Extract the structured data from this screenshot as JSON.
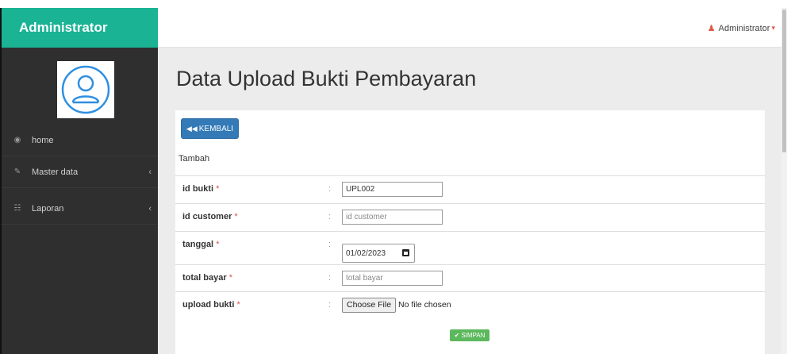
{
  "brand": {
    "title": "Administrator"
  },
  "header": {
    "user_label": "Administrator"
  },
  "sidebar": {
    "items": [
      {
        "label": "home",
        "icon": "dashboard-icon"
      },
      {
        "label": "Master data",
        "icon": "edit-icon"
      },
      {
        "label": "Laporan",
        "icon": "sitemap-icon"
      }
    ]
  },
  "main": {
    "title": "Data Upload Bukti Pembayaran",
    "back_label": "KEMBALI",
    "section_label": "Tambah",
    "fields": [
      {
        "label": "id bukti",
        "required": "*",
        "value": "UPL002",
        "placeholder": ""
      },
      {
        "label": "id customer",
        "required": "*",
        "value": "",
        "placeholder": "id customer"
      },
      {
        "label": "tanggal",
        "required": "*",
        "value": "01/02/2023"
      },
      {
        "label": "total bayar",
        "required": "*",
        "value": "",
        "placeholder": "total bayar"
      },
      {
        "label": "upload bukti",
        "required": "*",
        "button": "Choose File",
        "status": "No file chosen"
      }
    ],
    "colon": ":",
    "save_label": "SIMPAN"
  },
  "colors": {
    "brand": "#1ab394",
    "sidebar": "#2f2f2f",
    "primary": "#337ab7",
    "success": "#5cb85c",
    "user_accent": "#e05b4a"
  }
}
